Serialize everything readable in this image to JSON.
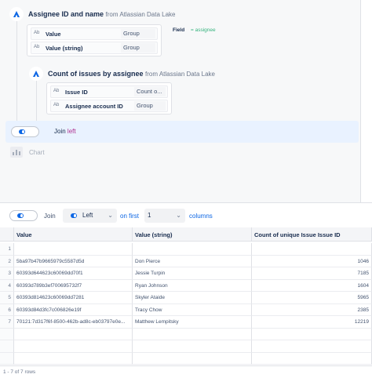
{
  "steps": [
    {
      "title": "Assignee ID and name",
      "from_prefix": "from",
      "source": "Atlassian Data Lake",
      "fields": [
        {
          "type_icon": "Ab",
          "name": "Value",
          "type": "Group"
        },
        {
          "type_icon": "Ab",
          "name": "Value (string)",
          "type": "Group"
        }
      ]
    },
    {
      "title": "Count of issues by assignee",
      "from_prefix": "from",
      "source": "Atlassian Data Lake",
      "fields": [
        {
          "type_icon": "Ab",
          "name": "Issue ID",
          "type": "Count o..."
        },
        {
          "type_icon": "Ab",
          "name": "Assignee account ID",
          "type": "Group"
        }
      ]
    }
  ],
  "field_mapping": {
    "label": "Field",
    "operator": "=",
    "value": "assignee"
  },
  "join_step": {
    "label": "Join",
    "kind": "left"
  },
  "chart_step": {
    "label": "Chart"
  },
  "toolbar": {
    "join_label": "Join",
    "join_type": "Left",
    "on_first_label": "on first",
    "column_count": "1",
    "columns_label": "columns"
  },
  "table": {
    "columns": [
      "Value",
      "Value (string)",
      "Count of unique Issue Issue ID"
    ],
    "rows": [
      {
        "n": "1",
        "value": "",
        "value_string": "",
        "count": ""
      },
      {
        "n": "2",
        "value": "5ba97b47b9665979c5587d5d",
        "value_string": "Don Pierce",
        "count": "1046"
      },
      {
        "n": "3",
        "value": "60393d644623c60069dd70f1",
        "value_string": "Jessie Turpin",
        "count": "7185"
      },
      {
        "n": "4",
        "value": "60393d789b3ef700695732f7",
        "value_string": "Ryan Johnson",
        "count": "1604"
      },
      {
        "n": "5",
        "value": "60393d814623c60069dd7281",
        "value_string": "Skyler Ataide",
        "count": "5965"
      },
      {
        "n": "6",
        "value": "60393d84d3fc7c006826e19f",
        "value_string": "Tracy Chow",
        "count": "2385"
      },
      {
        "n": "7",
        "value": "70121:7d317f6f-8500-462b-ad8c-eb03797e0e...",
        "value_string": "Matthew Lempitsky",
        "count": "12219"
      }
    ]
  },
  "footer": {
    "row_count": "1 - 7 of 7 rows"
  },
  "colors": {
    "accent": "#0c66e4",
    "join_highlight": "#e9f2ff",
    "left_keyword": "#ae2e8e",
    "field_value": "#36b37e"
  }
}
